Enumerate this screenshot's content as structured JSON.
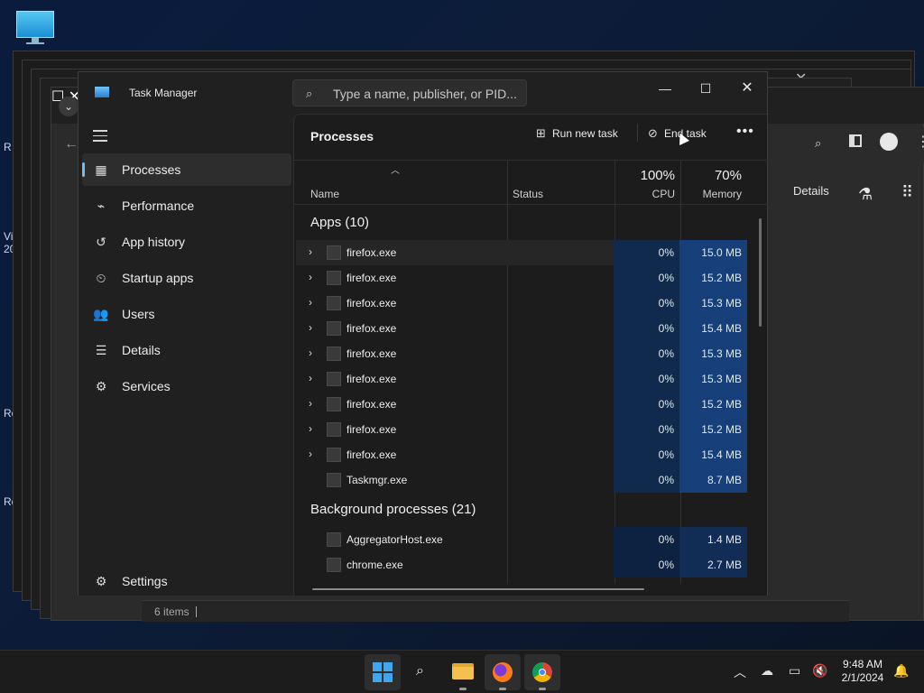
{
  "desktop": {
    "side_labels": [
      "R",
      "Vi",
      "20",
      "Ro",
      "Ro"
    ]
  },
  "background_window": {
    "details_label": "Details",
    "status_items": "6 items"
  },
  "task_manager": {
    "title": "Task Manager",
    "search_placeholder": "Type a name, publisher, or PID...",
    "nav": [
      {
        "label": "Processes",
        "icon": "processes-icon",
        "active": true
      },
      {
        "label": "Performance",
        "icon": "performance-icon"
      },
      {
        "label": "App history",
        "icon": "app-history-icon"
      },
      {
        "label": "Startup apps",
        "icon": "startup-apps-icon"
      },
      {
        "label": "Users",
        "icon": "users-icon"
      },
      {
        "label": "Details",
        "icon": "details-icon"
      },
      {
        "label": "Services",
        "icon": "services-icon"
      }
    ],
    "settings_label": "Settings",
    "page_title": "Processes",
    "commands": {
      "run_new_task": "Run new task",
      "end_task": "End task"
    },
    "columns": {
      "name": "Name",
      "status": "Status",
      "cpu_pct": "100%",
      "cpu": "CPU",
      "memory_pct": "70%",
      "memory": "Memory"
    },
    "apps_group": "Apps (10)",
    "apps": [
      {
        "name": "firefox.exe",
        "cpu": "0%",
        "memory": "15.0 MB",
        "expandable": true
      },
      {
        "name": "firefox.exe",
        "cpu": "0%",
        "memory": "15.2 MB",
        "expandable": true
      },
      {
        "name": "firefox.exe",
        "cpu": "0%",
        "memory": "15.3 MB",
        "expandable": true
      },
      {
        "name": "firefox.exe",
        "cpu": "0%",
        "memory": "15.4 MB",
        "expandable": true
      },
      {
        "name": "firefox.exe",
        "cpu": "0%",
        "memory": "15.3 MB",
        "expandable": true
      },
      {
        "name": "firefox.exe",
        "cpu": "0%",
        "memory": "15.3 MB",
        "expandable": true
      },
      {
        "name": "firefox.exe",
        "cpu": "0%",
        "memory": "15.2 MB",
        "expandable": true
      },
      {
        "name": "firefox.exe",
        "cpu": "0%",
        "memory": "15.2 MB",
        "expandable": true
      },
      {
        "name": "firefox.exe",
        "cpu": "0%",
        "memory": "15.4 MB",
        "expandable": true
      },
      {
        "name": "Taskmgr.exe",
        "cpu": "0%",
        "memory": "8.7 MB",
        "expandable": false
      }
    ],
    "background_group": "Background processes (21)",
    "background": [
      {
        "name": "AggregatorHost.exe",
        "cpu": "0%",
        "memory": "1.4 MB"
      },
      {
        "name": "chrome.exe",
        "cpu": "0%",
        "memory": "2.7 MB"
      }
    ]
  },
  "taskbar": {
    "time": "9:48 AM",
    "date": "2/1/2024",
    "apps": [
      "start",
      "search",
      "file-explorer",
      "firefox",
      "chrome"
    ]
  }
}
